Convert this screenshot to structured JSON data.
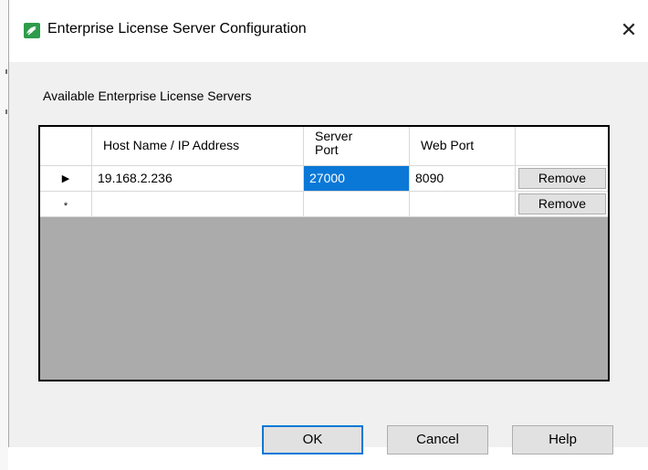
{
  "window": {
    "title": "Enterprise License Server Configuration"
  },
  "section_label": "Available Enterprise License Servers",
  "grid": {
    "columns": [
      "Host Name / IP Address",
      "Server\nPort",
      "Web Port"
    ],
    "rows": [
      {
        "indicator": "▶",
        "host": "19.168.2.236",
        "server_port": "27000",
        "web_port": "8090",
        "action": "Remove"
      },
      {
        "indicator": "*",
        "host": "",
        "server_port": "",
        "web_port": "",
        "action": "Remove"
      }
    ]
  },
  "buttons": {
    "ok": "OK",
    "cancel": "Cancel",
    "help": "Help"
  },
  "icons": {
    "app": "license-app-icon",
    "close": "close-icon"
  },
  "colors": {
    "selection": "#0a78d7",
    "default_button_border": "#0078d7"
  }
}
